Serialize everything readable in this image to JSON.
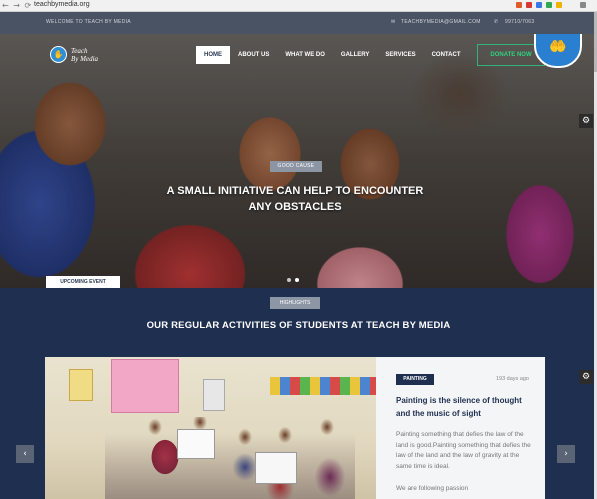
{
  "browser": {
    "url": "teachbymedia.org",
    "nav_glyphs": "← → ⟳",
    "extension_colors": [
      "#e05a2b",
      "#d93636",
      "#3b78e7",
      "#2fa84f",
      "#f0b400",
      "#888888"
    ]
  },
  "topbar": {
    "welcome": "WELCOME TO TEACH BY MEDIA",
    "email_icon": "envelope-icon",
    "email": "TEACHBYMEDIA@GMAIL.COM",
    "phone_icon": "phone-icon",
    "phone": "99710/7063"
  },
  "header": {
    "logo_line1": "Teach",
    "logo_line2": "By Media",
    "menu": [
      {
        "label": "HOME",
        "active": true
      },
      {
        "label": "ABOUT US",
        "active": false
      },
      {
        "label": "WHAT WE DO",
        "active": false
      },
      {
        "label": "GALLERY",
        "active": false
      },
      {
        "label": "SERVICES",
        "active": false
      },
      {
        "label": "CONTACT",
        "active": false
      }
    ],
    "donate_label": "DONATE NOW",
    "accent": "#2fb37a"
  },
  "hero": {
    "badge": "GOOD CAUSE",
    "headline_line1": "A SMALL INITIATIVE CAN HELP TO ENCOUNTER",
    "headline_line2": "ANY OBSTACLES",
    "upcoming_event": "UPCOMING EVENT",
    "slides": 2,
    "active_slide": 2
  },
  "highlights": {
    "badge": "HIGHLIGHTS",
    "title": "OUR REGULAR ACTIVITIES OF STUDENTS AT TEACH BY MEDIA",
    "card": {
      "category": "PAINTING",
      "time_ago": "193 days ago",
      "title": "Painting is the silence of thought and the music of sight",
      "excerpt": "Painting something that defies the law of the land is good.Painting something that defies the law of the land and the law of gravity at the same time is ideal.",
      "more": "We are following passion"
    },
    "prev_label": "‹",
    "next_label": "›",
    "brand_color": "#1f2f4f"
  }
}
